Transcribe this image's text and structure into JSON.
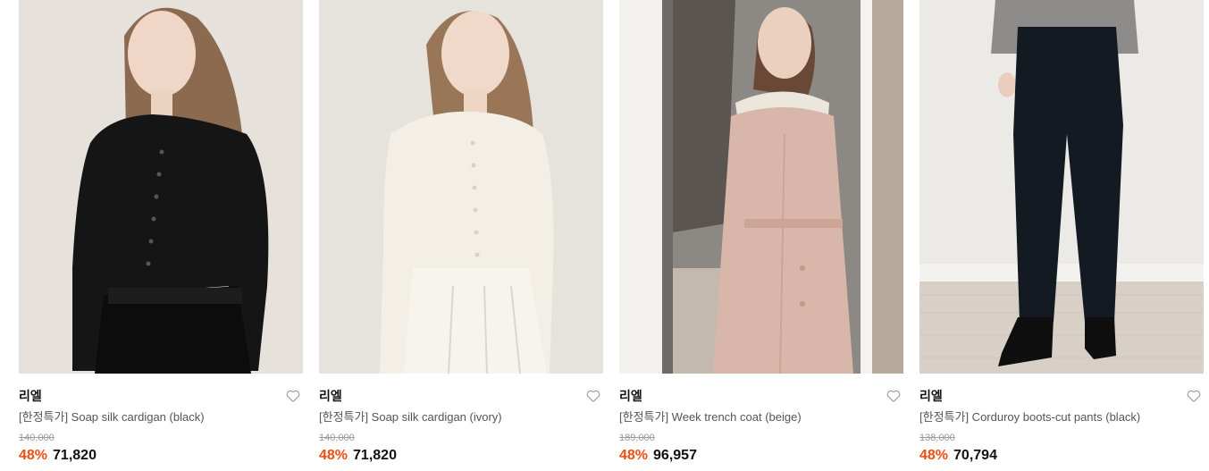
{
  "products": [
    {
      "brand": "리엘",
      "name": "[한정특가] Soap silk cardigan (black)",
      "original_price": "140,000",
      "discount": "48%",
      "price": "71,820",
      "image": "model in black cropped cardigan and black skirt"
    },
    {
      "brand": "리엘",
      "name": "[한정특가] Soap silk cardigan (ivory)",
      "original_price": "140,000",
      "discount": "48%",
      "price": "71,820",
      "image": "model in ivory cropped cardigan and white pleated skirt"
    },
    {
      "brand": "리엘",
      "name": "[한정특가] Week trench coat (beige)",
      "original_price": "189,000",
      "discount": "48%",
      "price": "96,957",
      "image": "model in beige trench coat by a window"
    },
    {
      "brand": "리엘",
      "name": "[한정특가] Corduroy boots-cut pants (black)",
      "original_price": "138,000",
      "discount": "48%",
      "price": "70,794",
      "image": "model in black corduroy boots-cut pants"
    }
  ],
  "colors": {
    "discount": "#f04e14",
    "brand_text": "#111111",
    "name_text": "#555555",
    "strike_text": "#9a9a9a"
  },
  "icons": {
    "wishlist": "heart-outline-icon"
  }
}
